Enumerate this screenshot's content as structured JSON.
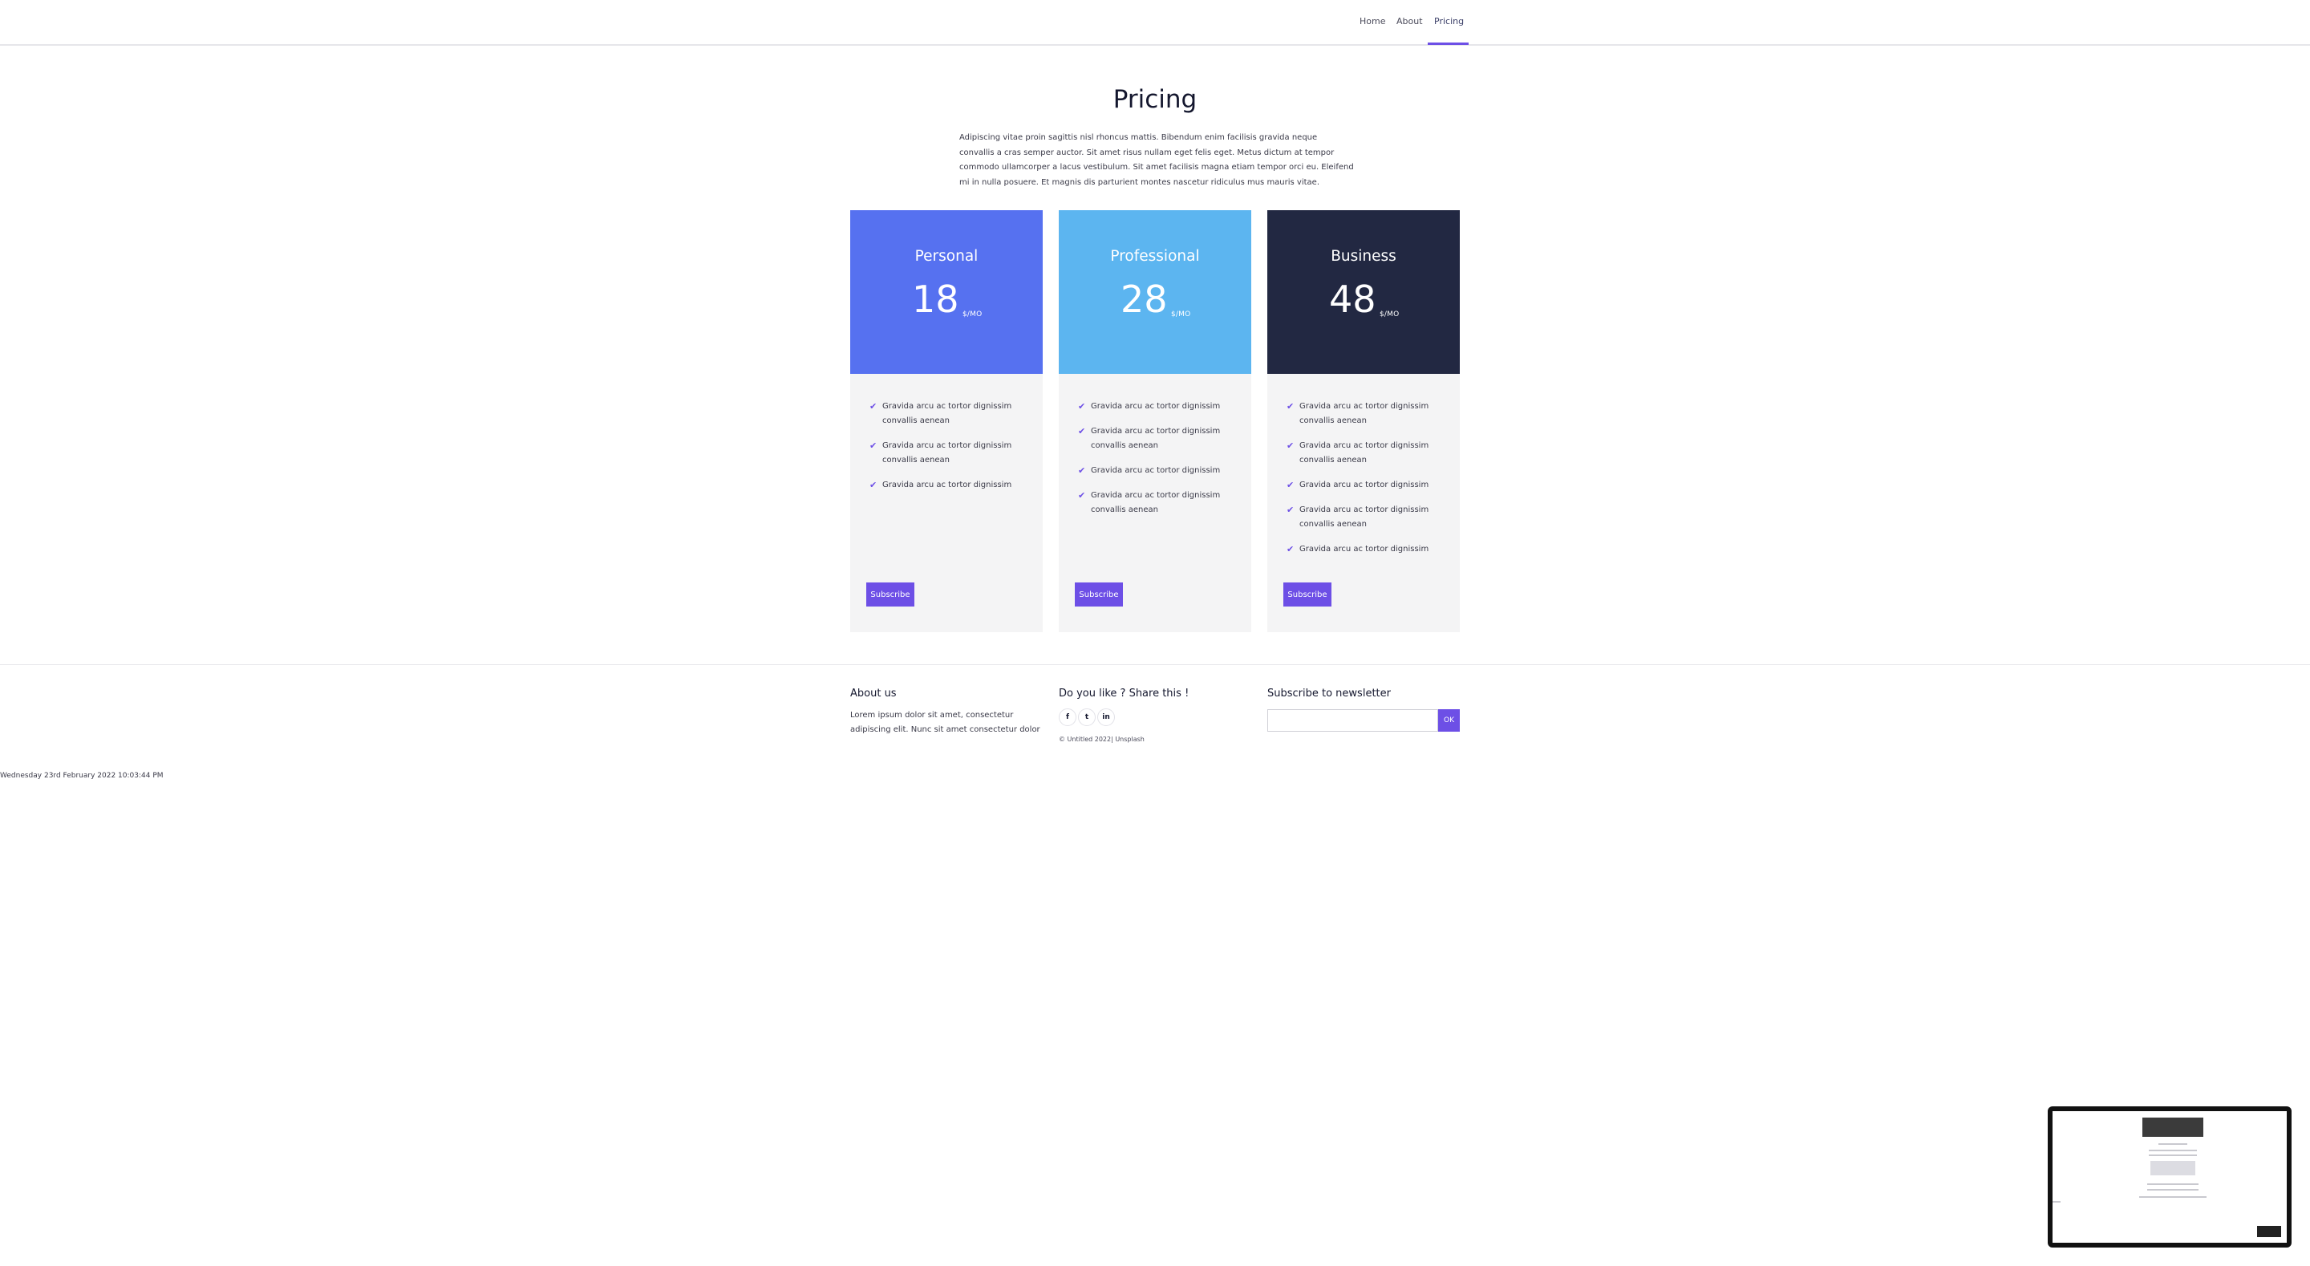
{
  "nav": {
    "items": [
      {
        "label": "Home"
      },
      {
        "label": "About"
      },
      {
        "label": "Pricing",
        "active": true
      }
    ]
  },
  "header": {
    "title": "Pricing",
    "intro": "Adipiscing vitae proin sagittis nisl rhoncus mattis. Bibendum enim facilisis gravida neque convallis a cras semper auctor. Sit amet risus nullam eget felis eget. Metus dictum at tempor commodo ullamcorper a lacus vestibulum. Sit amet facilisis magna etiam tempor orci eu. Eleifend mi in nulla posuere. Et magnis dis parturient montes nascetur ridiculus mus mauris vitae."
  },
  "plans": [
    {
      "name": "Personal",
      "price": "18",
      "period": "$/MO",
      "color": "#5671f0",
      "features": [
        "Gravida arcu ac tortor dignissim convallis aenean",
        "Gravida arcu ac tortor dignissim convallis aenean",
        "Gravida arcu ac tortor dignissim"
      ],
      "button": "Subscribe"
    },
    {
      "name": "Professional",
      "price": "28",
      "period": "$/MO",
      "color": "#5cb5f0",
      "features": [
        "Gravida arcu ac tortor dignissim",
        "Gravida arcu ac tortor dignissim convallis aenean",
        "Gravida arcu ac tortor dignissim",
        "Gravida arcu ac tortor dignissim convallis aenean"
      ],
      "button": "Subscribe"
    },
    {
      "name": "Business",
      "price": "48",
      "period": "$/MO",
      "color": "#222842",
      "features": [
        "Gravida arcu ac tortor dignissim convallis aenean",
        "Gravida arcu ac tortor dignissim convallis aenean",
        "Gravida arcu ac tortor dignissim",
        "Gravida arcu ac tortor dignissim convallis aenean",
        "Gravida arcu ac tortor dignissim"
      ],
      "button": "Subscribe"
    }
  ],
  "footer": {
    "about_title": "About us",
    "about_text": "Lorem ipsum dolor sit amet, consectetur adipiscing elit. Nunc sit amet consectetur dolor",
    "share_title": "Do you like ? Share this !",
    "social": [
      {
        "icon": "facebook-icon",
        "glyph": "f"
      },
      {
        "icon": "twitter-icon",
        "glyph": "t"
      },
      {
        "icon": "linkedin-icon",
        "glyph": "in"
      }
    ],
    "copyright": "© Untitled 2022| Unsplash",
    "newsletter_title": "Subscribe to newsletter",
    "newsletter_placeholder": "",
    "ok_label": "OK"
  },
  "timestamp": "Wednesday 23rd February 2022 10:03:44 PM",
  "accent": "#6d4fe6"
}
